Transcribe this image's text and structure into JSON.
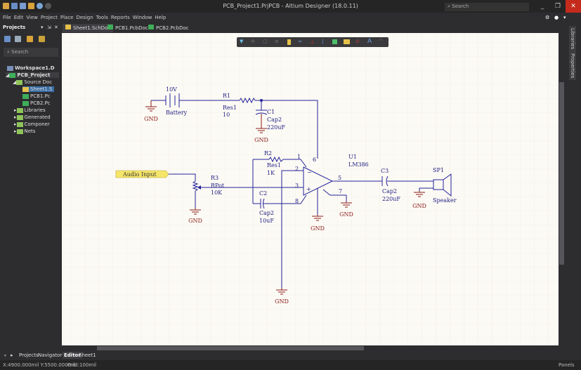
{
  "window": {
    "title": "PCB_Project1.PrjPCB - Altium Designer (18.0.11)",
    "search_placeholder": "Search",
    "minimize": "_",
    "restore": "❐",
    "close": "✕"
  },
  "menu": [
    "File",
    "Edit",
    "View",
    "Project",
    "Place",
    "Design",
    "Tools",
    "Reports",
    "Window",
    "Help"
  ],
  "projects_panel": {
    "title": "Projects",
    "search_placeholder": "Search",
    "controls": [
      "▾",
      "⇲",
      "✕"
    ],
    "tree": [
      {
        "label": "Workspace1.D",
        "level": 0
      },
      {
        "label": "PCB_Project",
        "level": 1
      },
      {
        "label": "Source Doc",
        "level": 2
      },
      {
        "label": "Sheet1.S",
        "level": 3,
        "selected": true
      },
      {
        "label": "PCB1.Pc",
        "level": 3
      },
      {
        "label": "PCB2.Pc",
        "level": 3
      },
      {
        "label": "Libraries",
        "level": 2
      },
      {
        "label": "Generated",
        "level": 2
      },
      {
        "label": "Componer",
        "level": 2
      },
      {
        "label": "Nets",
        "level": 2
      }
    ]
  },
  "doc_tabs": [
    {
      "label": "Sheet1.SchDoc",
      "active": true
    },
    {
      "label": "PCB1.PcbDoc *"
    },
    {
      "label": "PCB2.PcbDoc"
    }
  ],
  "right_panels": [
    "Libraries",
    "Properties"
  ],
  "bottom_tabs": {
    "left": [
      "Projects",
      "Navigator"
    ],
    "editor": [
      "Editor",
      "Sheet1"
    ]
  },
  "status": {
    "coords": "X:4900.000mil Y:5500.000mil",
    "grid": "Grid:100mil",
    "panels": "Panels"
  },
  "schematic": {
    "battery": {
      "value": "10V",
      "name": "Battery"
    },
    "r1": {
      "designator": "R1",
      "comment": "Res1",
      "value": "10"
    },
    "c1": {
      "designator": "C1",
      "comment": "Cap2",
      "value": "220uF"
    },
    "r2": {
      "designator": "R2",
      "comment": "Res1",
      "value": "1K"
    },
    "r3": {
      "designator": "R3",
      "comment": "RPot",
      "value": "10K"
    },
    "c2": {
      "designator": "C2",
      "comment": "Cap2",
      "value": "10uF"
    },
    "c3": {
      "designator": "C3",
      "comment": "Cap2",
      "value": "220uF"
    },
    "u1": {
      "designator": "U1",
      "comment": "LM386",
      "pins": [
        "1",
        "2",
        "3",
        "8",
        "5",
        "7",
        "6"
      ],
      "minus": "−",
      "plus": "+"
    },
    "sp1": {
      "designator": "SP1",
      "comment": "Speaker"
    },
    "port": "Audio Input",
    "gnd": "GND"
  },
  "colors": {
    "wire": "#24249c",
    "ground": "#8b1a1a",
    "port": "#f5e66a",
    "canvas": "#fcfaf4"
  }
}
